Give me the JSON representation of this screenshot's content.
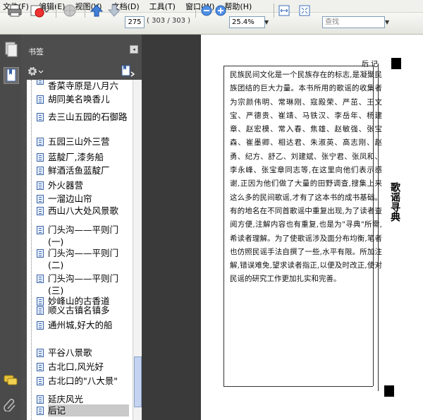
{
  "menu": {
    "items": [
      "文件(F)",
      "编辑(E)",
      "视图(V)",
      "文档(D)",
      "工具(T)",
      "窗口(W)",
      "帮助(H)"
    ]
  },
  "toolbar": {
    "page_number": "275",
    "page_total": "( 303 / 303 )",
    "zoom": "25.4%",
    "find_placeholder": "查找"
  },
  "bookmarks": {
    "title": "书签",
    "items": [
      "香菜寺原是八月六",
      "胡同美名唤香儿",
      "去三山五园的石御路",
      "五园三山外三营",
      "蓝靛厂,漆务船",
      "鲜酒活鱼蓝靛厂",
      "外火器营",
      "一溜边山帘",
      "西山八大处风景歌",
      "门头沟——平则门(一)",
      "门头沟——平则门(二)",
      "门头沟——平则门(三)",
      "妙峰山的古香道",
      "顺义古镇名镇多",
      "通州城,好大的船",
      "平谷八景歌",
      "古北口,风光好",
      "古北口的\"八大景\"",
      "延庆风光",
      "后记"
    ]
  },
  "document": {
    "header": "后  记",
    "side_title": "歌谣寻典",
    "body": "民族民间文化是一个民族存在的标志,是凝聚民族团结的巨大力量。本书所用的歌谣的收集者为宗颜伟明、常琳刚、寇殿荣、严茁、王文宝、严德贵、崔靖、马铁汉、李岳年、杨建章、赵宏模、常入春、焦雄、赵敏强、张宝森、崔墨卿、相达君、朱淑英、高志刚、赵勇、纪方、舒乙、刘建斌、张宁君、张凤和、李永峰、张宝章同志等,在这里向他们表示感谢,正因为他们做了大量的田野调查,搜集上来这么多的民间歌谣,才有了这本书的成书基础。有的地名在不同首歌谣中重复出现,为了读者查阅方便,注解内容也有重复,也是为\"寻典\"所需,希读者理解。为了使歌谣涉及面分布均衡,笔者也仿照民谣手法自撰了一些,水平有限。所加注解,错误难免,望求读者指正,以便及时改正,使对民谣的研究工作更加扎实和完善。"
  }
}
